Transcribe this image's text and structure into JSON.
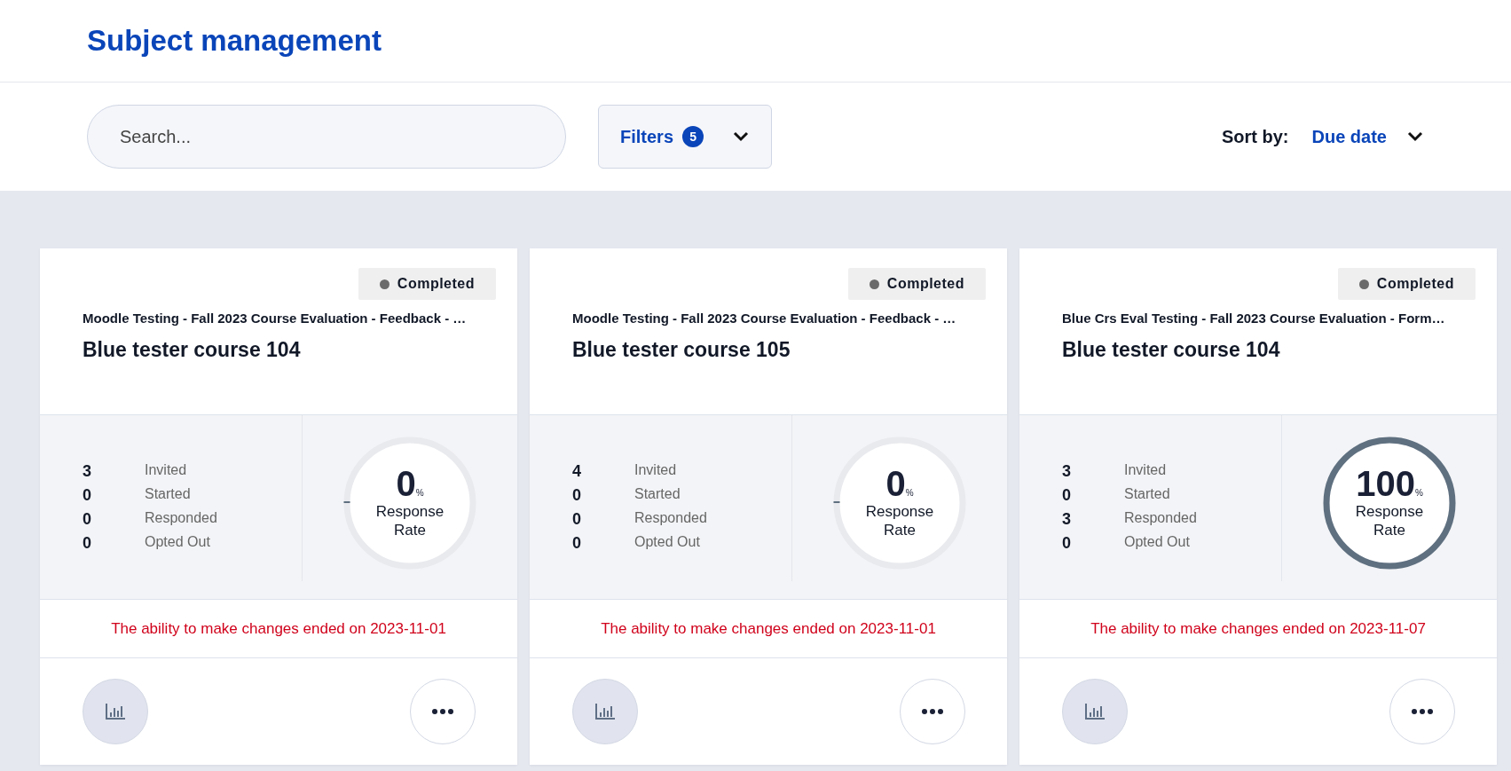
{
  "header": {
    "title": "Subject management"
  },
  "toolbar": {
    "search": {
      "placeholder": "Search..."
    },
    "filters": {
      "label": "Filters",
      "count": "5"
    },
    "sort": {
      "label": "Sort by:",
      "value": "Due date"
    }
  },
  "cards": [
    {
      "status": "Completed",
      "project": "Moodle Testing - Fall 2023 Course Evaluation - Feedback - …",
      "title": "Blue tester course 104",
      "stats": [
        {
          "value": "3",
          "label": "Invited"
        },
        {
          "value": "0",
          "label": "Started"
        },
        {
          "value": "0",
          "label": "Responded"
        },
        {
          "value": "0",
          "label": "Opted Out"
        }
      ],
      "response": {
        "value": "0",
        "unit": "%",
        "label": "Response Rate",
        "level": 0
      },
      "message": "The ability to make changes ended on 2023-11-01"
    },
    {
      "status": "Completed",
      "project": "Moodle Testing - Fall 2023 Course Evaluation - Feedback - …",
      "title": "Blue tester course 105",
      "stats": [
        {
          "value": "4",
          "label": "Invited"
        },
        {
          "value": "0",
          "label": "Started"
        },
        {
          "value": "0",
          "label": "Responded"
        },
        {
          "value": "0",
          "label": "Opted Out"
        }
      ],
      "response": {
        "value": "0",
        "unit": "%",
        "label": "Response Rate",
        "level": 0
      },
      "message": "The ability to make changes ended on 2023-11-01"
    },
    {
      "status": "Completed",
      "project": "Blue Crs Eval Testing - Fall 2023 Course Evaluation - Form…",
      "title": "Blue tester course 104",
      "stats": [
        {
          "value": "3",
          "label": "Invited"
        },
        {
          "value": "0",
          "label": "Started"
        },
        {
          "value": "3",
          "label": "Responded"
        },
        {
          "value": "0",
          "label": "Opted Out"
        }
      ],
      "response": {
        "value": "100",
        "unit": "%",
        "label": "Response Rate",
        "level": 1
      },
      "message": "The ability to make changes ended on 2023-11-07"
    }
  ]
}
